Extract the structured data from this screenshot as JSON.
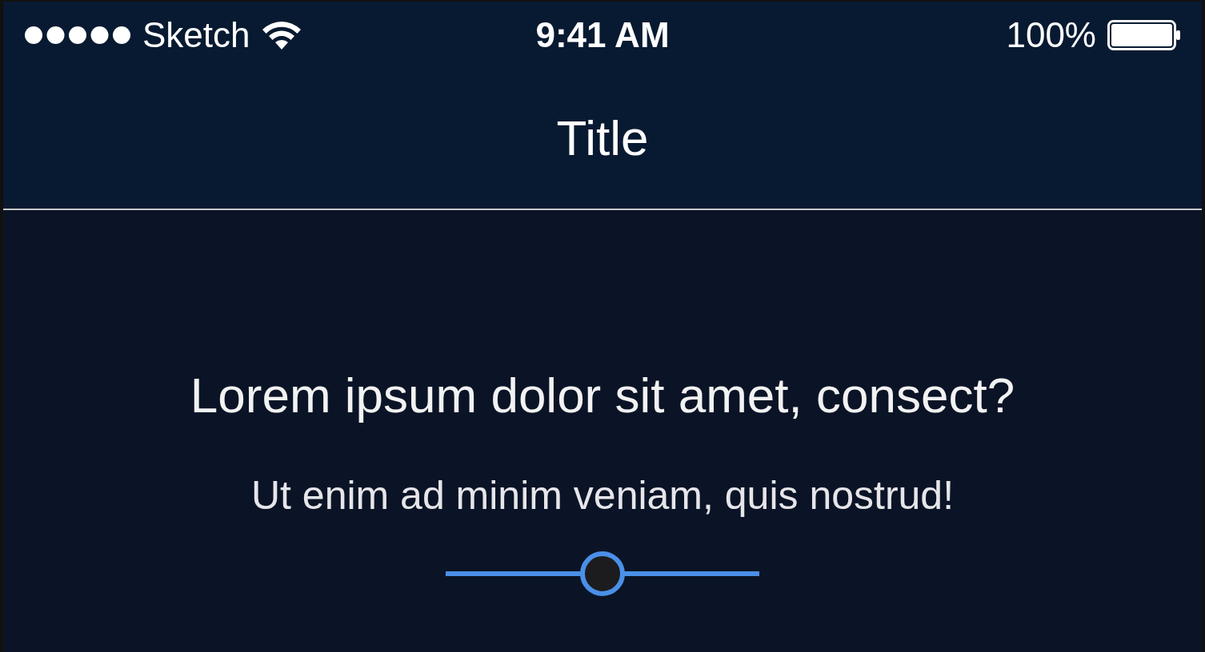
{
  "status_bar": {
    "carrier": "Sketch",
    "time": "9:41 AM",
    "battery": "100%"
  },
  "nav_bar": {
    "title": "Title"
  },
  "content": {
    "heading": "Lorem ipsum dolor sit amet, consect?",
    "subheading": "Ut enim ad minim veniam, quis nostrud!",
    "slider": {
      "level": 0.5
    }
  }
}
